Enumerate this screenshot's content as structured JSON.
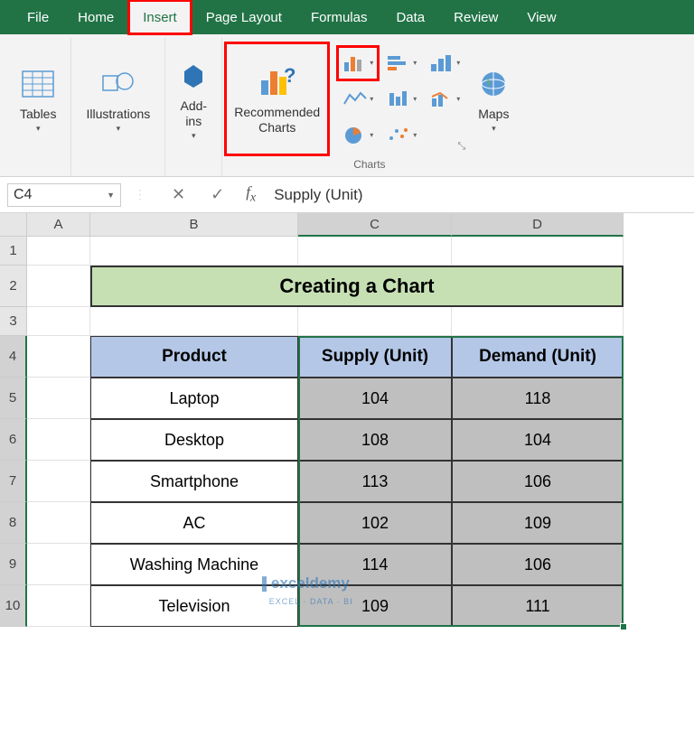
{
  "ribbon": {
    "tabs": [
      "File",
      "Home",
      "Insert",
      "Page Layout",
      "Formulas",
      "Data",
      "Review",
      "View"
    ],
    "active_tab": "Insert",
    "groups": {
      "tables": {
        "label": "Tables"
      },
      "illustrations": {
        "label": "Illustrations"
      },
      "addins": {
        "label": "Add-\nins"
      },
      "rec_charts": {
        "label": "Recommended\nCharts"
      },
      "charts_group": "Charts",
      "maps": {
        "label": "Maps"
      }
    }
  },
  "formula_bar": {
    "name_box": "C4",
    "formula": "Supply (Unit)"
  },
  "columns": [
    "A",
    "B",
    "C",
    "D"
  ],
  "rows": [
    "1",
    "2",
    "3",
    "4",
    "5",
    "6",
    "7",
    "8",
    "9",
    "10"
  ],
  "sheet": {
    "title": "Creating a Chart",
    "headers": [
      "Product",
      "Supply (Unit)",
      "Demand (Unit)"
    ],
    "data": [
      {
        "product": "Laptop",
        "supply": "104",
        "demand": "118"
      },
      {
        "product": "Desktop",
        "supply": "108",
        "demand": "104"
      },
      {
        "product": "Smartphone",
        "supply": "113",
        "demand": "106"
      },
      {
        "product": "AC",
        "supply": "102",
        "demand": "109"
      },
      {
        "product": "Washing Machine",
        "supply": "114",
        "demand": "106"
      },
      {
        "product": "Television",
        "supply": "109",
        "demand": "111"
      }
    ]
  },
  "watermark": {
    "name": "exceldemy",
    "tag": "EXCEL · DATA · BI"
  }
}
